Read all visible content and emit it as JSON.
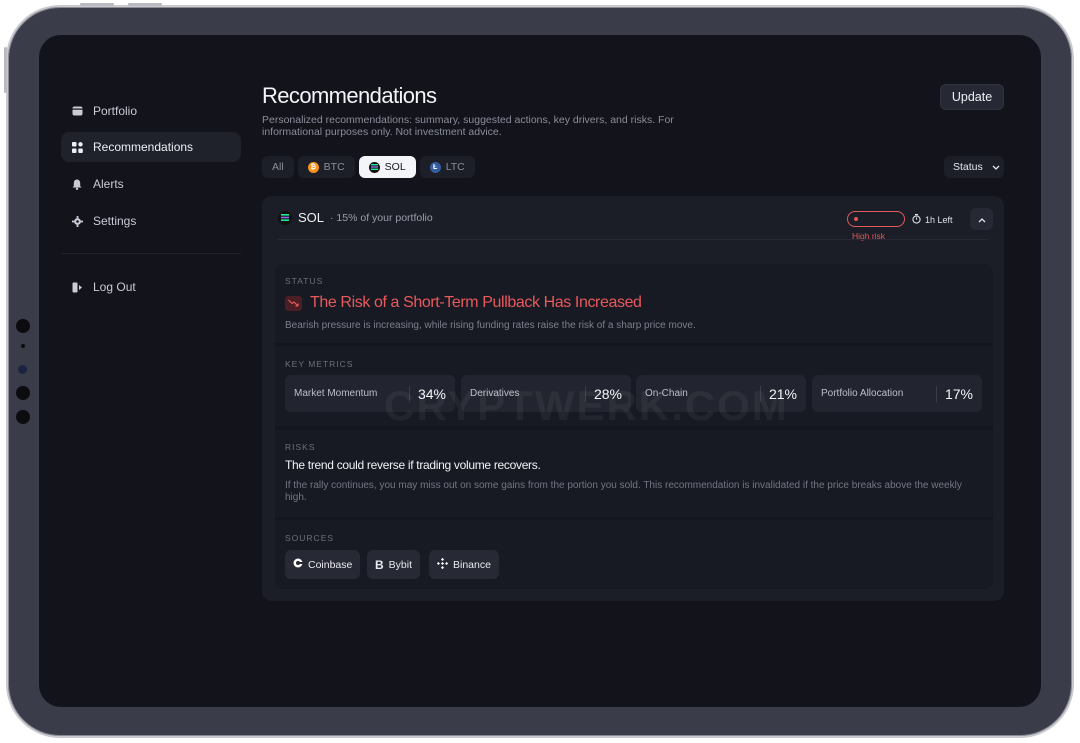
{
  "nav": {
    "items": [
      {
        "label": "Portfolio",
        "icon": "wallet-icon"
      },
      {
        "label": "Recommendations",
        "icon": "grid-icon"
      },
      {
        "label": "Alerts",
        "icon": "bell-icon"
      },
      {
        "label": "Settings",
        "icon": "gear-icon"
      }
    ],
    "logout_label": "Log Out"
  },
  "header": {
    "title": "Recommendations",
    "subtitle": "Personalized recommendations: summary, suggested actions, key drivers, and risks. For informational purposes only. Not investment advice.",
    "update_label": "Update"
  },
  "filters": {
    "tabs": [
      {
        "label": "All"
      },
      {
        "label": "BTC",
        "icon": "bitcoin-icon",
        "color": "#f7931a"
      },
      {
        "label": "SOL",
        "icon": "solana-icon",
        "color": "#14f195"
      },
      {
        "label": "LTC",
        "icon": "litecoin-icon",
        "color": "#345d9d"
      }
    ],
    "selected": "SOL",
    "status_label": "Status"
  },
  "card": {
    "asset": "SOL",
    "portfolio_share": "· 15% of your portfolio",
    "risk_label": "High risk",
    "risk_color": "#e05a5a",
    "time_left": "1h Left",
    "status": {
      "label": "STATUS",
      "title": "The Risk of a Short-Term Pullback Has Increased",
      "description": "Bearish pressure is increasing, while rising funding rates raise the risk of a sharp price move."
    },
    "metrics": {
      "label": "KEY METRICS",
      "items": [
        {
          "name": "Market Momentum",
          "value": "34%"
        },
        {
          "name": "Derivatives",
          "value": "28%"
        },
        {
          "name": "On-Chain",
          "value": "21%"
        },
        {
          "name": "Portfolio Allocation",
          "value": "17%"
        }
      ]
    },
    "risks": {
      "label": "RISKS",
      "headline": "The trend could reverse if trading volume recovers.",
      "body": "If the rally continues, you may miss out on some gains from the portion you sold. This recommendation is invalidated if the price breaks above the weekly high."
    },
    "sources": {
      "label": "SOURCES",
      "items": [
        {
          "name": "Coinbase",
          "icon": "coinbase-icon"
        },
        {
          "name": "Bybit",
          "icon": "bybit-icon"
        },
        {
          "name": "Binance",
          "icon": "binance-icon"
        }
      ]
    }
  },
  "watermark": "CRYPTWERK.COM"
}
